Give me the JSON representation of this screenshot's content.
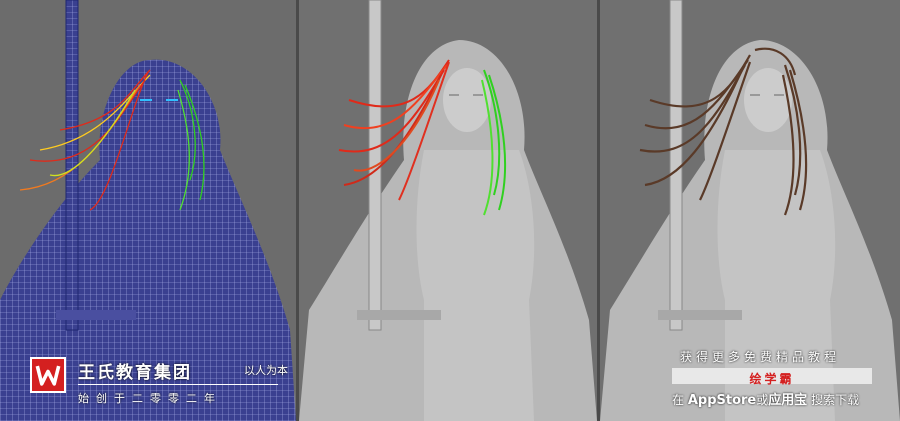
{
  "brand": {
    "title": "王氏教育集团",
    "motto": "以人为本",
    "subtitle": "始创于二零零二年"
  },
  "promo": {
    "top_text": "获得更多免费精品教程",
    "app_name": "绘学霸",
    "bottom_prefix": "在",
    "bottom_store": "AppStore",
    "bottom_mid": "或",
    "bottom_market": "应用宝",
    "bottom_suffix": "搜索下载"
  },
  "panels": [
    {
      "name": "wireframe-view",
      "mode": "wireframe"
    },
    {
      "name": "guide-curves-view",
      "mode": "hair-guides"
    },
    {
      "name": "final-hair-view",
      "mode": "render"
    }
  ],
  "colors": {
    "background": "#6e6e6e",
    "model_gray": "#b8b8b8",
    "wire_blue": "#2a3aa8",
    "hair_red": "#e02a1a",
    "hair_green": "#30d020",
    "hair_brown": "#5a3a28",
    "brand_red": "#d42020"
  }
}
